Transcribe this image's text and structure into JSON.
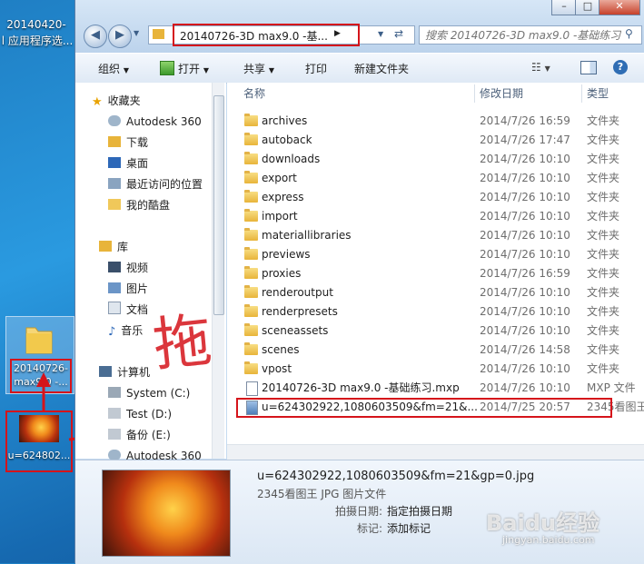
{
  "desktop": {
    "top_icon_label_1": "20140420-",
    "top_icon_label_2": "l 应用程序选...",
    "folder_icon_label_1": "20140726-",
    "folder_icon_label_2": "max9.0 -...",
    "image_icon_label": "u=624802..."
  },
  "window": {
    "address": "20140726-3D max9.0 -基...",
    "search_placeholder": "搜索 20140726-3D max9.0 -基础练习",
    "caption_min": "–",
    "caption_max": "□",
    "caption_close": "✕"
  },
  "toolbar": {
    "organize": "组织",
    "open": "打开",
    "share": "共享",
    "print": "打印",
    "new_folder": "新建文件夹"
  },
  "nav": {
    "favorites_header": "收藏夹",
    "favorites": [
      "Autodesk 360",
      "下载",
      "桌面",
      "最近访问的位置",
      "我的酷盘"
    ],
    "libraries_header": "库",
    "libraries": [
      "视频",
      "图片",
      "文档",
      "音乐"
    ],
    "computer_header": "计算机",
    "computer": [
      "System (C:)",
      "Test (D:)",
      "备份 (E:)",
      "Autodesk 360"
    ]
  },
  "columns": {
    "name": "名称",
    "date": "修改日期",
    "type": "类型"
  },
  "files": [
    {
      "name": "archives",
      "date": "2014/7/26 16:59",
      "type": "文件夹",
      "kind": "folder"
    },
    {
      "name": "autoback",
      "date": "2014/7/26 17:47",
      "type": "文件夹",
      "kind": "folder"
    },
    {
      "name": "downloads",
      "date": "2014/7/26 10:10",
      "type": "文件夹",
      "kind": "folder"
    },
    {
      "name": "export",
      "date": "2014/7/26 10:10",
      "type": "文件夹",
      "kind": "folder"
    },
    {
      "name": "express",
      "date": "2014/7/26 10:10",
      "type": "文件夹",
      "kind": "folder"
    },
    {
      "name": "import",
      "date": "2014/7/26 10:10",
      "type": "文件夹",
      "kind": "folder"
    },
    {
      "name": "materiallibraries",
      "date": "2014/7/26 10:10",
      "type": "文件夹",
      "kind": "folder"
    },
    {
      "name": "previews",
      "date": "2014/7/26 10:10",
      "type": "文件夹",
      "kind": "folder"
    },
    {
      "name": "proxies",
      "date": "2014/7/26 16:59",
      "type": "文件夹",
      "kind": "folder"
    },
    {
      "name": "renderoutput",
      "date": "2014/7/26 10:10",
      "type": "文件夹",
      "kind": "folder"
    },
    {
      "name": "renderpresets",
      "date": "2014/7/26 10:10",
      "type": "文件夹",
      "kind": "folder"
    },
    {
      "name": "sceneassets",
      "date": "2014/7/26 10:10",
      "type": "文件夹",
      "kind": "folder"
    },
    {
      "name": "scenes",
      "date": "2014/7/26 14:58",
      "type": "文件夹",
      "kind": "folder"
    },
    {
      "name": "vpost",
      "date": "2014/7/26 10:10",
      "type": "文件夹",
      "kind": "folder"
    },
    {
      "name": "20140726-3D max9.0 -基础练习.mxp",
      "date": "2014/7/26 10:10",
      "type": "MXP 文件",
      "kind": "file"
    },
    {
      "name": "u=624302922,1080603509&fm=21&...",
      "date": "2014/7/25 20:57",
      "type": "2345看图王",
      "kind": "image"
    }
  ],
  "details": {
    "filename": "u=624302922,1080603509&fm=21&gp=0.jpg",
    "filetype": "2345看图王 JPG 图片文件",
    "date_label": "拍摄日期:",
    "date_value": "指定拍摄日期",
    "tag_label": "标记:",
    "tag_value": "添加标记"
  },
  "annotation": {
    "handwritten": "拖"
  },
  "watermark": {
    "brand": "Baidu经验",
    "url": "jingyan.baidu.com"
  },
  "colors": {
    "highlight_red": "#d5141b",
    "window_frame": "#c5daf0"
  }
}
